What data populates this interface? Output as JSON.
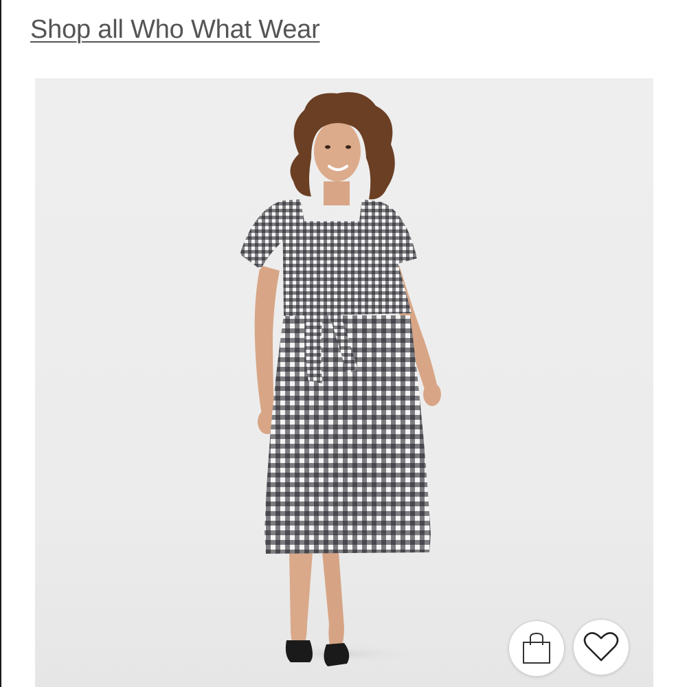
{
  "header": {
    "shop_link_label": "Shop all Who What Wear"
  },
  "product": {
    "image_icon": "gingham-midi-dress-photo",
    "pattern_colors": {
      "dark": "#1c1c22",
      "light": "#f4f4f4"
    },
    "background_color": "#ececec"
  },
  "actions": {
    "bag_icon": "shopping-bag-icon",
    "favorite_icon": "heart-icon"
  }
}
